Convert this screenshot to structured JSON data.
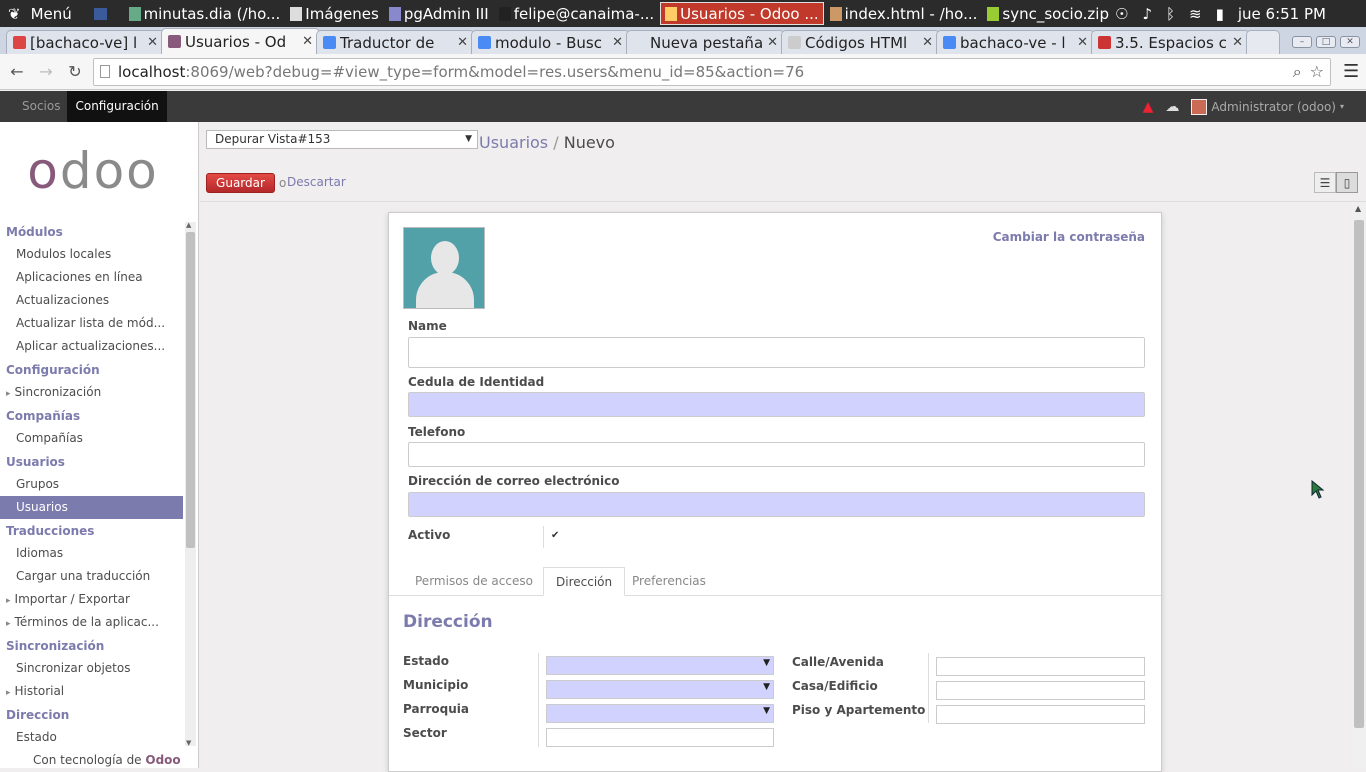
{
  "taskbar": {
    "menu_label": "Menú",
    "tasks": [
      {
        "label": "minutas.dia (/ho...",
        "color": "#6a8"
      },
      {
        "label": "Imágenes",
        "color": "#ddd"
      },
      {
        "label": "pgAdmin III",
        "color": "#88c"
      },
      {
        "label": "felipe@canaima-...",
        "color": "#222"
      },
      {
        "label": "Usuarios - Odoo ...",
        "color": "#fc6",
        "active": true
      },
      {
        "label": "index.html - /ho...",
        "color": "#c96"
      },
      {
        "label": "sync_socio.zip",
        "color": "#9c3"
      }
    ],
    "clock": "jue  6:51 PM"
  },
  "browser": {
    "tabs": [
      {
        "title": "[bachaco-ve] l",
        "fav_color": "#d44"
      },
      {
        "title": "Usuarios - Od",
        "fav_color": "#875a7b",
        "active": true
      },
      {
        "title": "Traductor de",
        "fav_color": "#4a8af4"
      },
      {
        "title": "modulo - Busc",
        "fav_color": "#4a8af4"
      },
      {
        "title": "Nueva pestaña",
        "fav_color": ""
      },
      {
        "title": "Códigos HTMl",
        "fav_color": "#ccc"
      },
      {
        "title": "bachaco-ve - l",
        "fav_color": "#4a8af4"
      },
      {
        "title": "3.5. Espacios c",
        "fav_color": "#c33"
      }
    ],
    "url_host": "localhost",
    "url_path": ":8069/web?debug=#view_type=form&model=res.users&menu_id=85&action=76"
  },
  "topmenu": {
    "items": [
      "Socios",
      "Configuración"
    ],
    "active_index": 1,
    "user": "Administrator (odoo)"
  },
  "sidebar": {
    "logo": "odoo",
    "sections": [
      {
        "title": "Módulos",
        "items": [
          {
            "label": "Modulos locales"
          },
          {
            "label": "Aplicaciones en línea"
          },
          {
            "label": "Actualizaciones"
          },
          {
            "label": "Actualizar lista de mód..."
          },
          {
            "label": "Aplicar actualizaciones..."
          }
        ]
      },
      {
        "title": "Configuración",
        "items": [
          {
            "label": "Sincronización",
            "caret": true
          }
        ]
      },
      {
        "title": "Compañías",
        "items": [
          {
            "label": "Compañías"
          }
        ]
      },
      {
        "title": "Usuarios",
        "items": [
          {
            "label": "Grupos"
          },
          {
            "label": "Usuarios",
            "active": true
          }
        ]
      },
      {
        "title": "Traducciones",
        "items": [
          {
            "label": "Idiomas"
          },
          {
            "label": "Cargar una traducción"
          },
          {
            "label": "Importar / Exportar",
            "caret": true
          },
          {
            "label": "Términos de la aplicac...",
            "caret": true
          }
        ]
      },
      {
        "title": "Sincronización",
        "items": [
          {
            "label": "Sincronizar objetos"
          },
          {
            "label": "Historial",
            "caret": true
          }
        ]
      },
      {
        "title": "Direccion",
        "items": [
          {
            "label": "Estado"
          }
        ]
      }
    ],
    "powered_by": "Con tecnología de ",
    "powered_brand": "Odoo"
  },
  "header": {
    "debug_view": "Depurar Vista#153",
    "breadcrumb_parent": "Usuarios",
    "breadcrumb_sep": "/",
    "breadcrumb_current": "Nuevo",
    "save_label": "Guardar",
    "or_label": "o",
    "discard_label": "Descartar"
  },
  "form": {
    "change_password": "Cambiar la contraseña",
    "name_label": "Name",
    "name_value": "",
    "cedula_label": "Cedula de Identidad",
    "cedula_value": "",
    "telefono_label": "Telefono",
    "telefono_value": "",
    "email_label": "Dirección de correo electrónico",
    "email_value": "",
    "activo_label": "Activo",
    "activo_checked": true,
    "tabs": [
      "Permisos de acceso",
      "Dirección",
      "Preferencias"
    ],
    "active_tab": 1,
    "section_title": "Dirección",
    "address": {
      "estado_label": "Estado",
      "municipio_label": "Municipio",
      "parroquia_label": "Parroquia",
      "sector_label": "Sector",
      "calle_label": "Calle/Avenida",
      "casa_label": "Casa/Edificio",
      "piso_label": "Piso y Apartemento"
    }
  },
  "colors": {
    "accent": "#7c7bad",
    "brand": "#875a7b",
    "required_field": "#d2d2ff",
    "save_button": "#d9534f"
  }
}
